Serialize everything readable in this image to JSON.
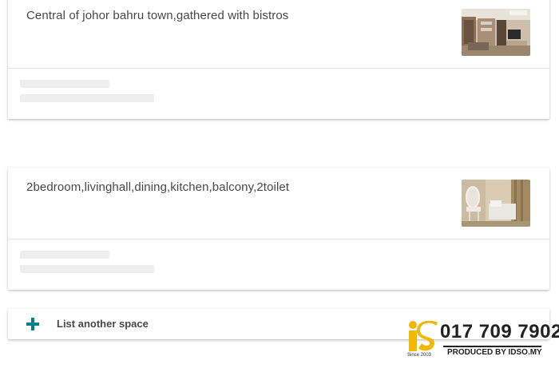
{
  "listings": [
    {
      "title": "Central of johor bahru town,gathered with bistros",
      "thumbnail": "living-room-photo"
    },
    {
      "title": "2bedroom,livinghall,dining,kitchen,balcony,2toilet",
      "thumbnail": "bedroom-photo"
    }
  ],
  "list_another": {
    "label": "List another space",
    "icon": "plus-icon",
    "icon_color": "#008489"
  },
  "watermark": {
    "phone": "017 709 7902",
    "produced_by": "PRODUCED BY IDSO.MY",
    "since": "Since 2003",
    "logo_text": "iS",
    "logo_color": "#f5b800"
  },
  "colors": {
    "text": "#484848",
    "skeleton": "#eeeeee",
    "accent": "#008489"
  }
}
